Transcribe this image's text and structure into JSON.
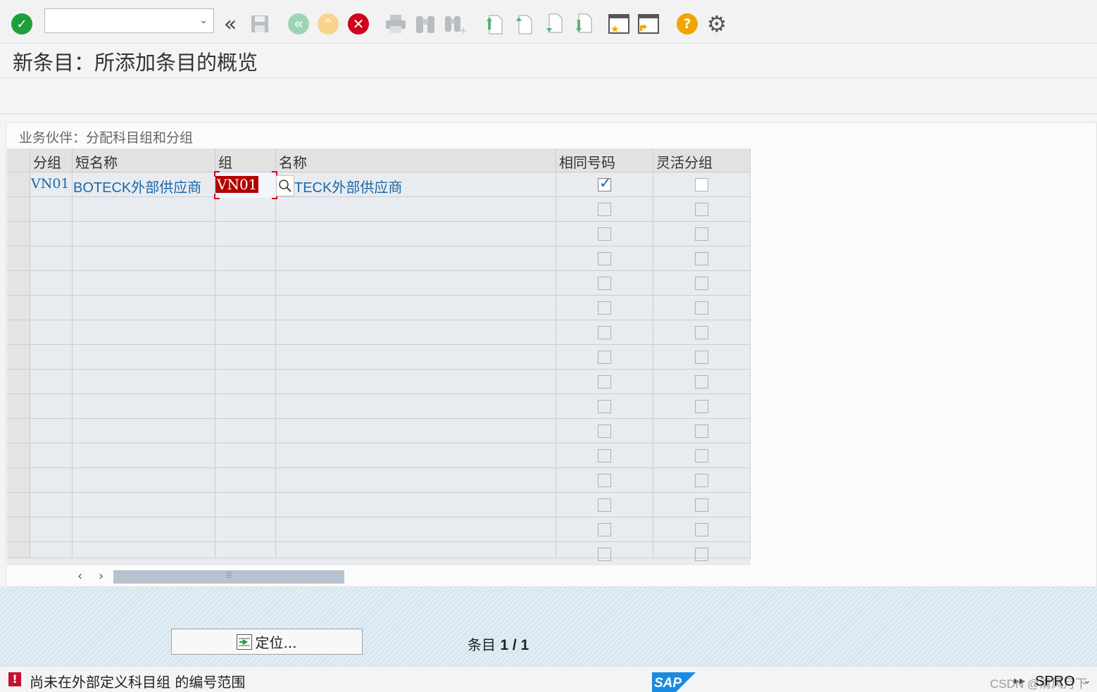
{
  "toolbar": {
    "command_field_value": "",
    "colors": {
      "green": "#1e9e3a",
      "red": "#d0021b",
      "help": "#f0a500",
      "nav": "#9ed4b4"
    }
  },
  "screen_title": "新条目：所添加条目的概览",
  "panel_title": "业务伙伴：分配科目组和分组",
  "table": {
    "headers": [
      "分组",
      "短名称",
      "组",
      "名称",
      "相同号码",
      "灵活分组"
    ],
    "rows": [
      {
        "group": "VN01",
        "short_name": "BOTECK外部供应商",
        "account_group": "VN01",
        "name": "TECK外部供应商",
        "same_number": true,
        "flexible": false
      }
    ]
  },
  "position_button": "定位...",
  "entry_label": "条目",
  "entry_count": "1 / 1",
  "status": {
    "message": "尚未在外部定义科目组  的编号范围",
    "tcode": "SPRO",
    "watermark": "CSDN @清风月下"
  }
}
